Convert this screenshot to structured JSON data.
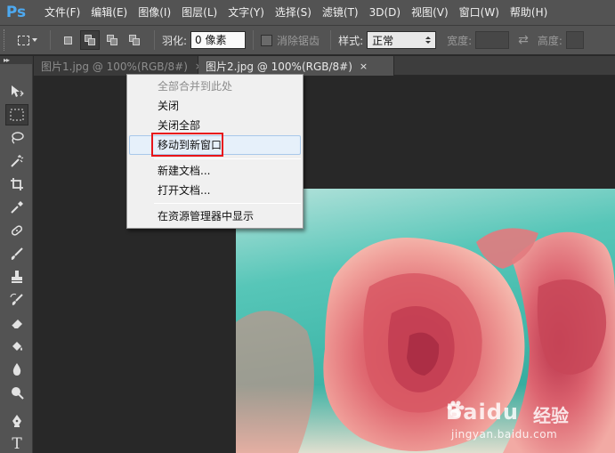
{
  "app": {
    "logo": "Ps"
  },
  "menubar": {
    "items": [
      "文件(F)",
      "编辑(E)",
      "图像(I)",
      "图层(L)",
      "文字(Y)",
      "选择(S)",
      "滤镜(T)",
      "3D(D)",
      "视图(V)",
      "窗口(W)",
      "帮助(H)"
    ]
  },
  "options": {
    "feather_label": "羽化:",
    "feather_value": "0 像素",
    "antialias_label": "消除锯齿",
    "style_label": "样式:",
    "style_value": "正常",
    "width_label": "宽度:",
    "height_label": "高度:"
  },
  "tabs": [
    {
      "label": "图片1.jpg @ 100%(RGB/8#)",
      "close": "×",
      "active": false
    },
    {
      "label": "图片2.jpg @ 100%(RGB/8#)",
      "close": "×",
      "active": true
    }
  ],
  "context_menu": {
    "items": [
      {
        "label": "全部合并到此处",
        "enabled": false
      },
      {
        "label": "关闭",
        "enabled": true
      },
      {
        "label": "关闭全部",
        "enabled": true
      },
      {
        "label": "移动到新窗口",
        "enabled": true,
        "hovered": true,
        "highlighted": true
      },
      {
        "label": "新建文档...",
        "enabled": true
      },
      {
        "label": "打开文档...",
        "enabled": true
      },
      {
        "label": "在资源管理器中显示",
        "enabled": true
      }
    ]
  },
  "watermark": {
    "logo": "Bai",
    "logo_suffix": "du",
    "cn": "经验",
    "url": "jingyan.baidu.com"
  },
  "colors": {
    "ui_dark": "#535353",
    "canvas_bg": "#282828",
    "highlight_red": "#e8161a",
    "ps_blue": "#4da9f0"
  },
  "tools": [
    "move-tool-icon",
    "marquee-tool-icon",
    "lasso-tool-icon",
    "magic-wand-icon",
    "crop-tool-icon",
    "eyedropper-icon",
    "healing-brush-icon",
    "brush-tool-icon",
    "clone-stamp-icon",
    "history-brush-icon",
    "eraser-icon",
    "paint-bucket-icon",
    "blur-tool-icon",
    "dodge-tool-icon",
    "pen-tool-icon",
    "type-tool-icon"
  ]
}
